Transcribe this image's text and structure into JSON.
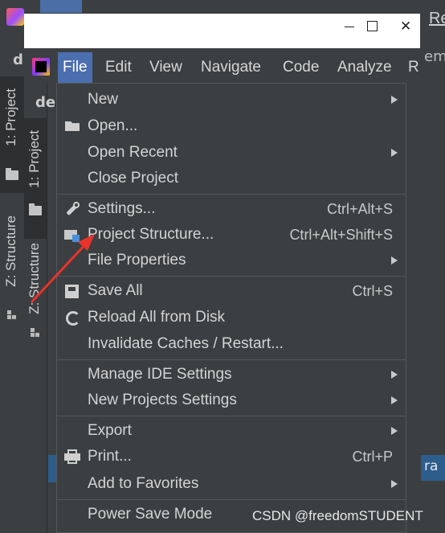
{
  "back_window": {
    "title_fragment": "Re",
    "left_fragment": "d",
    "right_fragment": "em",
    "bottom_right_fragment": "ra",
    "sidebar": [
      "1: Project",
      "Z: Structure"
    ]
  },
  "window": {
    "minimize": "—",
    "maximize": "☐",
    "close": "✕"
  },
  "inner": {
    "panel_fragment": "de",
    "sidebar": [
      "1: Project",
      "Z: Structure"
    ]
  },
  "menubar": {
    "items": [
      "File",
      "Edit",
      "View",
      "Navigate",
      "Code",
      "Analyze",
      "R"
    ]
  },
  "file_menu": {
    "items": [
      {
        "label": "New",
        "shortcut": "",
        "submenu": true,
        "icon": ""
      },
      {
        "label": "Open...",
        "shortcut": "",
        "submenu": false,
        "icon": "folder-open-icon"
      },
      {
        "label": "Open Recent",
        "shortcut": "",
        "submenu": true,
        "icon": ""
      },
      {
        "label": "Close Project",
        "shortcut": "",
        "submenu": false,
        "icon": ""
      },
      {
        "label": "Settings...",
        "shortcut": "Ctrl+Alt+S",
        "submenu": false,
        "icon": "wrench-icon"
      },
      {
        "label": "Project Structure...",
        "shortcut": "Ctrl+Alt+Shift+S",
        "submenu": false,
        "icon": "project-structure-icon"
      },
      {
        "label": "File Properties",
        "shortcut": "",
        "submenu": true,
        "icon": ""
      },
      {
        "label": "Save All",
        "shortcut": "Ctrl+S",
        "submenu": false,
        "icon": "save-icon"
      },
      {
        "label": "Reload All from Disk",
        "shortcut": "",
        "submenu": false,
        "icon": "reload-icon"
      },
      {
        "label": "Invalidate Caches / Restart...",
        "shortcut": "",
        "submenu": false,
        "icon": ""
      },
      {
        "label": "Manage IDE Settings",
        "shortcut": "",
        "submenu": true,
        "icon": ""
      },
      {
        "label": "New Projects Settings",
        "shortcut": "",
        "submenu": true,
        "icon": ""
      },
      {
        "label": "Export",
        "shortcut": "",
        "submenu": true,
        "icon": ""
      },
      {
        "label": "Print...",
        "shortcut": "Ctrl+P",
        "submenu": false,
        "icon": "print-icon"
      },
      {
        "label": "Add to Favorites",
        "shortcut": "",
        "submenu": true,
        "icon": ""
      },
      {
        "label": "Power Save Mode",
        "shortcut": "",
        "submenu": false,
        "icon": ""
      }
    ]
  },
  "watermark": "CSDN @freedomSTUDENT",
  "colors": {
    "background": "#3c3f41",
    "menu_active": "#4b6eaf",
    "annotation": "#e8332b"
  }
}
